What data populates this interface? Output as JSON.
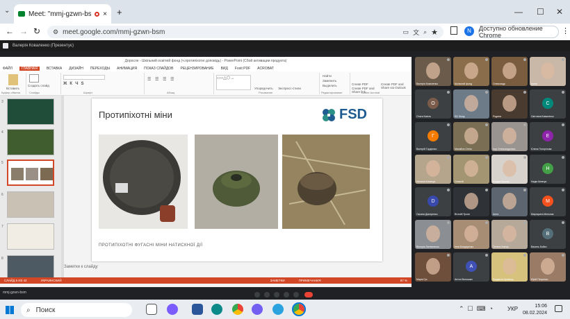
{
  "browser": {
    "tab_title": "Meet: \"mmj-gzwn-bsm\"",
    "close_tab": "×",
    "new_tab": "+",
    "url": "meet.google.com/mmj-gzwn-bsm",
    "update_label": "Доступно обновление Chrome",
    "profile_initial": "N"
  },
  "meet": {
    "presenter_bar": "Валерія Коваленко (Презентує)",
    "meeting_code_label": "mmj-gzwn-bsm"
  },
  "ppt": {
    "window_title": "Доросле - Шкільний освітній фонд (ч.протипіхотні доповідь) - PowerPoint (Сбой активации продукта)",
    "menu": [
      "ФАЙЛ",
      "ГЛАВНАЯ",
      "ВСТАВКА",
      "ДИЗАЙН",
      "ПЕРЕХОДЫ",
      "АНИМАЦИЯ",
      "ПОКАЗ СЛАЙДОВ",
      "РЕЦЕНЗИРОВАНИЕ",
      "ВИД",
      "Foxit PDF",
      "ACROBAT"
    ],
    "ribbon_groups": [
      "Буфер обмена",
      "Слайды",
      "Шрифт",
      "Абзац",
      "Рисование",
      "Редактирование",
      "Adobe Acrobat"
    ],
    "ribbon_buttons": {
      "paste": "Вставить",
      "create_slide": "Создать слайд",
      "arrange": "Упорядочить",
      "quick_styles": "Экспресс-стили",
      "find": "Найти",
      "replace": "Заменить",
      "select": "Выделить",
      "create_pdf": "Create PDF",
      "create_pdf_share": "Create PDF and Share link",
      "share_outlook": "Create PDF and Share via Outlook"
    },
    "thumb_numbers": [
      "3",
      "4",
      "5",
      "6",
      "7",
      "8"
    ],
    "slide": {
      "title": "Протипіхотні міни",
      "logo_text": "FSD",
      "caption": "ПРОТИПІХОТНІ ФУГАСНІ  МІНИ НАТИСКНОЇ ДІЇ"
    },
    "notes_placeholder": "Заметки к слайду",
    "status_left": "СЛАЙД 5 ИЗ 42",
    "status_lang": "УКРАИНСКИЙ",
    "status_notes": "ЗАМЕТКИ",
    "status_comments": "ПРИМЕЧАНИЯ",
    "zoom": "87 %"
  },
  "participants": [
    {
      "name": "Валерія Коваленко",
      "type": "video",
      "color": "#6b5b4a"
    },
    {
      "name": "Шкільний фонд",
      "type": "video",
      "color": "#8a6d4a"
    },
    {
      "name": "Олександр",
      "type": "video",
      "color": "#7a5c3e"
    },
    {
      "name": "Ірина",
      "type": "video",
      "color": "#c9b8a8"
    },
    {
      "name": "Ольга Кисіль",
      "type": "avatar",
      "initial": "О",
      "color": "#7b5b4a"
    },
    {
      "name": "SD Фонд",
      "type": "video",
      "color": "#6d7a88"
    },
    {
      "name": "Родина",
      "type": "video",
      "color": "#4a3b30"
    },
    {
      "name": "Світлана Коваленко",
      "type": "avatar",
      "initial": "С",
      "color": "#00897b"
    },
    {
      "name": "Валерій Гордієнко",
      "type": "avatar",
      "initial": "Г",
      "color": "#f57c00"
    },
    {
      "name": "Михайло Сітнік",
      "type": "video",
      "color": "#7a6f55"
    },
    {
      "name": "Ігор Олександрович",
      "type": "video",
      "color": "#9a9490"
    },
    {
      "name": "Єлена Погорілова",
      "type": "avatar",
      "initial": "Е",
      "color": "#8e24aa"
    },
    {
      "name": "Наталія Климчук",
      "type": "video",
      "color": "#b6a58d"
    },
    {
      "name": "Олексій",
      "type": "video",
      "color": "#a39572"
    },
    {
      "name": "Богдан Кушнір",
      "type": "video",
      "color": "#d8d2cc"
    },
    {
      "name": "Надія Шевчук",
      "type": "avatar",
      "initial": "Н",
      "color": "#43a047"
    },
    {
      "name": "Оксана Дмитренко",
      "type": "avatar",
      "initial": "D",
      "color": "#3949ab"
    },
    {
      "name": "Віталій Троян",
      "type": "video",
      "color": "#2f3236"
    },
    {
      "name": "Анна",
      "type": "video",
      "color": "#5d6670"
    },
    {
      "name": "Маргарита Мельник",
      "type": "avatar",
      "initial": "M",
      "color": "#f4511e"
    },
    {
      "name": "Вікторія Литвиненко",
      "type": "video",
      "color": "#8b8f93"
    },
    {
      "name": "Інна Бондаренко",
      "type": "video",
      "color": "#a68d74"
    },
    {
      "name": "Тетяна Ємець",
      "type": "video",
      "color": "#b7a99a"
    },
    {
      "name": "Василь Бойко",
      "type": "avatar",
      "initial": "В",
      "color": "#546e7a"
    },
    {
      "name": "Марія Гуз",
      "type": "video",
      "color": "#6d4f3b"
    },
    {
      "name": "Антон Волошин",
      "type": "avatar",
      "initial": "А",
      "color": "#3f51b5"
    },
    {
      "name": "Людмила Кравець",
      "type": "video",
      "color": "#d6c27d"
    },
    {
      "name": "Юрій Петренко",
      "type": "video",
      "color": "#9a7b66"
    }
  ],
  "taskbar": {
    "search_placeholder": "Поиск",
    "lang": "УКР",
    "time": "15:06",
    "date": "08.02.2024"
  },
  "colors": {
    "ppt_accent": "#d24726",
    "fsd_blue": "#1d5b91",
    "fsd_teal": "#2a8f86"
  }
}
